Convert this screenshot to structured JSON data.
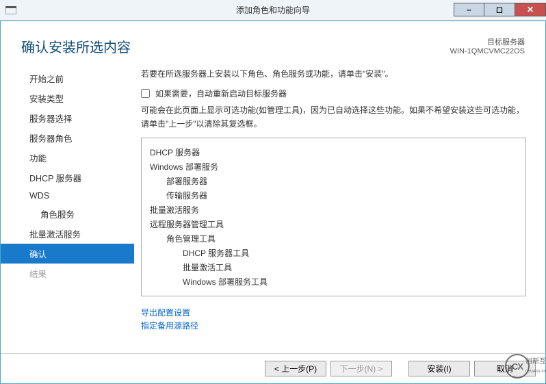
{
  "titlebar": {
    "title": "添加角色和功能向导"
  },
  "header": {
    "title": "确认安装所选内容",
    "target_label": "目标服务器",
    "target_value": "WIN-1QMCVMC22OS"
  },
  "sidebar": {
    "items": [
      {
        "label": "开始之前",
        "indent": false,
        "active": false,
        "disabled": false
      },
      {
        "label": "安装类型",
        "indent": false,
        "active": false,
        "disabled": false
      },
      {
        "label": "服务器选择",
        "indent": false,
        "active": false,
        "disabled": false
      },
      {
        "label": "服务器角色",
        "indent": false,
        "active": false,
        "disabled": false
      },
      {
        "label": "功能",
        "indent": false,
        "active": false,
        "disabled": false
      },
      {
        "label": "DHCP 服务器",
        "indent": false,
        "active": false,
        "disabled": false
      },
      {
        "label": "WDS",
        "indent": false,
        "active": false,
        "disabled": false
      },
      {
        "label": "角色服务",
        "indent": true,
        "active": false,
        "disabled": false
      },
      {
        "label": "批量激活服务",
        "indent": false,
        "active": false,
        "disabled": false
      },
      {
        "label": "确认",
        "indent": false,
        "active": true,
        "disabled": false
      },
      {
        "label": "结果",
        "indent": false,
        "active": false,
        "disabled": true
      }
    ]
  },
  "content": {
    "intro": "若要在所选服务器上安装以下角色、角色服务或功能，请单击\"安装\"。",
    "checkbox_label": "如果需要，自动重新启动目标服务器",
    "checkbox_checked": false,
    "desc": "可能会在此页面上显示可选功能(如管理工具)，因为已自动选择这些功能。如果不希望安装这些可选功能，请单击\"上一步\"以清除其复选框。",
    "items": [
      {
        "label": "DHCP 服务器",
        "level": 0
      },
      {
        "label": "Windows 部署服务",
        "level": 0
      },
      {
        "label": "部署服务器",
        "level": 1
      },
      {
        "label": "传输服务器",
        "level": 1
      },
      {
        "label": "批量激活服务",
        "level": 0
      },
      {
        "label": "远程服务器管理工具",
        "level": 0
      },
      {
        "label": "角色管理工具",
        "level": 1
      },
      {
        "label": "DHCP 服务器工具",
        "level": 2
      },
      {
        "label": "批量激活工具",
        "level": 2
      },
      {
        "label": "Windows 部署服务工具",
        "level": 2
      }
    ],
    "links": {
      "export": "导出配置设置",
      "alt_source": "指定备用源路径"
    }
  },
  "footer": {
    "prev": "< 上一步(P)",
    "next": "下一步(N) >",
    "install": "安装(I)",
    "cancel": "取消"
  },
  "watermark": {
    "logo_text": "CX",
    "line1": "创新互联",
    "line2": "CHUANG XIN HU LIAN"
  }
}
